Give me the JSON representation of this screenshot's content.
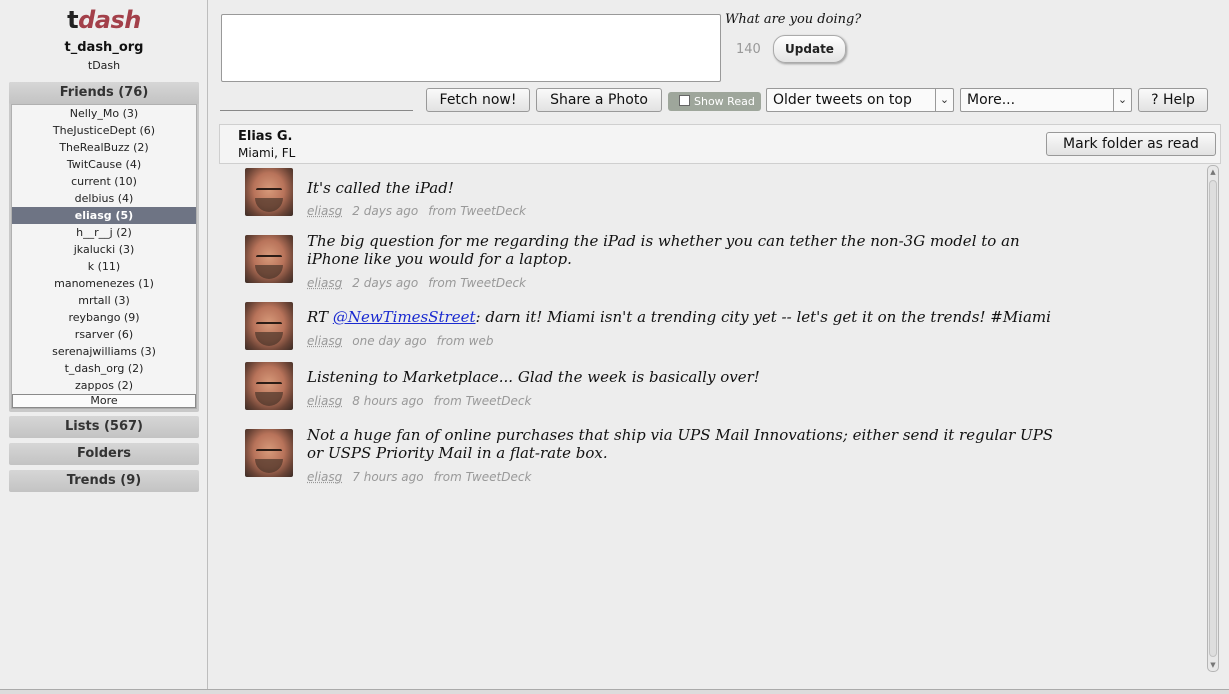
{
  "sidebar": {
    "logo_t": "t",
    "logo_dash": "dash",
    "account_name": "t_dash_org",
    "account_sub": "tDash",
    "friends_header": "Friends (76)",
    "friends": [
      "Nelly_Mo (3)",
      "TheJusticeDept (6)",
      "TheRealBuzz (2)",
      "TwitCause (4)",
      "current (10)",
      "delbius (4)",
      "eliasg (5)",
      "h__r__j (2)",
      "jkalucki (3)",
      "k (11)",
      "manomenezes (1)",
      "mrtall (3)",
      "reybango (9)",
      "rsarver (6)",
      "serenajwilliams (3)",
      "t_dash_org (2)",
      "zappos (2)"
    ],
    "active_friend_index": 6,
    "more_label": "More",
    "lists_label": "Lists (567)",
    "folders_label": "Folders",
    "trends_label": "Trends (9)"
  },
  "compose": {
    "prompt": "What are you doing?",
    "counter": "140",
    "update_label": "Update",
    "textarea_value": ""
  },
  "toolbar": {
    "fetch_label": "Fetch now!",
    "share_label": "Share a Photo",
    "show_read_label": "Show Read",
    "order_select": "Older tweets on top",
    "more_select": "More...",
    "help_label": "? Help"
  },
  "panel": {
    "name": "Elias G.",
    "location": "Miami, FL",
    "mark_read_label": "Mark folder as read"
  },
  "tweets": [
    {
      "text": "It's called the iPad!",
      "user": "eliasg",
      "time": "2 days ago",
      "source": "from TweetDeck"
    },
    {
      "text": "The big question for me regarding the iPad is whether you can tether the non-3G model to an iPhone like you would for a laptop.",
      "user": "eliasg",
      "time": "2 days ago",
      "source": "from TweetDeck"
    },
    {
      "text_prefix": "RT ",
      "mention": "@NewTimesStreet",
      "text_suffix": ": darn it! Miami isn't a trending city yet -- let's get it on the trends! #Miami",
      "user": "eliasg",
      "time": "one day ago",
      "source": "from web"
    },
    {
      "text": "Listening to Marketplace... Glad the week is basically over!",
      "user": "eliasg",
      "time": "8 hours ago",
      "source": "from TweetDeck"
    },
    {
      "text": "Not a huge fan of online purchases that ship via UPS Mail Innovations; either send it regular UPS or USPS Priority Mail in a flat-rate box.",
      "user": "eliasg",
      "time": "7 hours ago",
      "source": "from TweetDeck"
    }
  ],
  "icons": {
    "checkbox": "checkbox-icon",
    "dropdown": "chevron-down-icon",
    "scroll_up": "arrow-up-icon",
    "scroll_down": "arrow-down-icon"
  }
}
